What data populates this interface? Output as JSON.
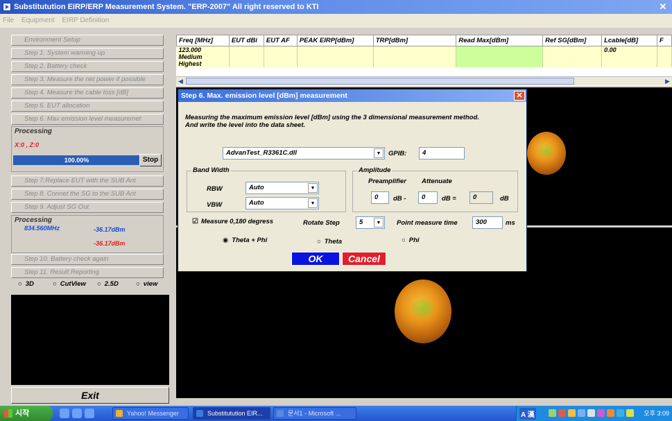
{
  "window": {
    "title": "Substitutution EIRP/ERP Measurement System. \"ERP-2007\" All right reserved to KTI",
    "menus": [
      "File",
      "Equipment",
      "EIRP Definition"
    ]
  },
  "steps": [
    "Environment Setup",
    "Step 1. System warming up",
    "Step 2. Battery check",
    "Step 3. Measure the net power if possible",
    "Step 4. Measure the cable loss [dB]",
    "Step 5. EUT allocation",
    "Step 6. Max emission level measuremet"
  ],
  "processing1": {
    "title": "Processing",
    "position": "X:0 , Z:0",
    "progress_text": "100.00%",
    "progress_fraction": 1.0,
    "stop_label": "Stop"
  },
  "steps2": [
    "Step 7.Replace EUT with the SUB Ant",
    "Step 8. Connet the SG to the SUB Ant",
    "Step 9. Adjust SG Out"
  ],
  "processing2": {
    "title": "Processing",
    "freq": "834.560MHz",
    "level1": "-36.17dBm",
    "level2": "-36.17dBm"
  },
  "steps3": [
    "Step 10. Battery check again",
    "Step 11. Result Reporting"
  ],
  "view_options": [
    "3D",
    "CutView",
    "2.5D",
    "view"
  ],
  "exit_label": "Exit",
  "grid": {
    "columns": [
      "Freq [MHz]",
      "EUT dBi",
      "EUT AF",
      "PEAK EIRP[dBm]",
      "TRP[dBm]",
      "Read Max[dBm]",
      "Ref SG[dBm]",
      "Lcable[dB]",
      "F"
    ],
    "rows": [
      [
        "123.000",
        "",
        "",
        "",
        "",
        "",
        "",
        "0.00",
        ""
      ],
      [
        "Medium",
        "",
        "",
        "",
        "",
        "",
        "",
        "",
        ""
      ],
      [
        "Highest",
        "",
        "",
        "",
        "",
        "",
        "",
        "",
        ""
      ]
    ]
  },
  "dialog": {
    "title": "Step 6. Max. emission level [dBm] measurement",
    "desc_line1": "Measuring the maximum emission level [dBm] using the 3 dimensional measurement method.",
    "desc_line2": "And write the level into the data sheet.",
    "instrument": "AdvanTest_R3361C.dll",
    "gpib_label": "GPIB:",
    "gpib_value": "4",
    "bandwidth": {
      "legend": "Band Width",
      "rbw_label": "RBW",
      "rbw_value": "Auto",
      "vbw_label": "VBW",
      "vbw_value": "Auto"
    },
    "amplitude": {
      "legend": "Amplitude",
      "preamp_label": "Preamplifier",
      "atten_label": "Attenuate",
      "preamp_value": "0",
      "unit1": "dB -",
      "atten_value": "0",
      "unit2": "dB =",
      "result_value": "0",
      "unit3": "dB"
    },
    "measure_label": "Measure 0,180 degress",
    "rotate_label": "Rotate Step",
    "rotate_value": "5",
    "point_time_label": "Point measure time",
    "point_time_value": "300",
    "point_time_unit": "ms",
    "polar_options": [
      "Theta + Phi",
      "Theta",
      "Phi"
    ],
    "polar_selected": "Theta + Phi",
    "ok_label": "OK",
    "cancel_label": "Cancel"
  },
  "taskbar": {
    "start_label": "시작",
    "tasks": [
      "Yahoo! Messenger",
      "Substitutution EIR...",
      "문서1 - Microsoft ..."
    ],
    "ime": "A 漢",
    "clock": "오후 3:09"
  }
}
